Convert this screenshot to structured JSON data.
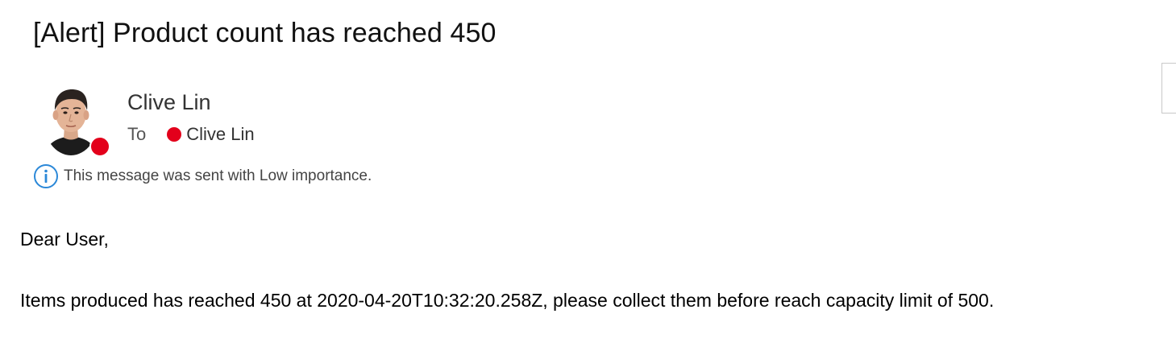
{
  "message": {
    "subject": "[Alert] Product count has reached 450",
    "sender": {
      "name": "Clive Lin",
      "presence_color": "#e3001b"
    },
    "to": {
      "label": "To",
      "recipient": "Clive Lin",
      "presence_color": "#e3001b"
    },
    "importance_notice": "This message was sent with Low importance.",
    "body": {
      "greeting": "Dear User,",
      "text": "Items produced has reached 450 at 2020-04-20T10:32:20.258Z, please collect them before reach capacity limit of 500."
    }
  },
  "icons": {
    "info": "info-icon",
    "avatar": "avatar"
  },
  "colors": {
    "info_blue": "#2b88d8",
    "presence_busy": "#e3001b"
  }
}
